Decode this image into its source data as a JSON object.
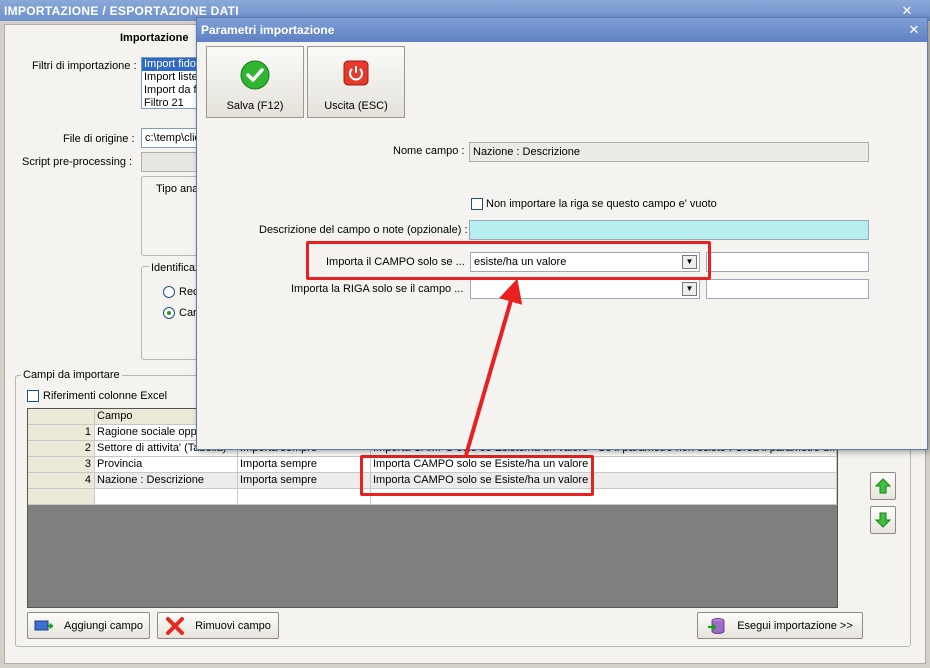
{
  "main_window": {
    "title": "IMPORTAZIONE / ESPORTAZIONE DATI",
    "section_title": "Importazione",
    "filters_label": "Filtri di importazione :",
    "filters": [
      "Import fido",
      "Import liste",
      "Import da f",
      "Filtro 21"
    ],
    "origin_file_label": "File di origine :",
    "origin_file_value": "c:\\temp\\clie",
    "script_label": "Script pre-processing :",
    "type_label": "Tipo ana",
    "identification_label": "Identificaz",
    "radio_1": "Rec",
    "radio_2": "Car",
    "fields_group_label": "Campi da importare",
    "excel_refs_label": "Riferimenti colonne Excel",
    "grid_header_campo": "Campo",
    "rows": [
      {
        "n": "1",
        "campo": "Ragione sociale oppu",
        "mode": "",
        "cond": ""
      },
      {
        "n": "2",
        "campo": "Settore di attivita' (Tabella)",
        "mode": "Importa sempre",
        "cond": "Importa CAMPO solo se Esiste/ha un valore - Se il parametro non esiste : Crea il parametro d..."
      },
      {
        "n": "3",
        "campo": "Provincia",
        "mode": "Importa sempre",
        "cond": "Importa CAMPO solo se Esiste/ha un valore"
      },
      {
        "n": "4",
        "campo": "Nazione : Descrizione",
        "mode": "Importa sempre",
        "cond": "Importa CAMPO solo se Esiste/ha un valore"
      }
    ],
    "add_field_button": "Aggiungi campo",
    "remove_field_button": "Rimuovi campo",
    "run_import_button": "Esegui importazione >>"
  },
  "dialog": {
    "title": "Parametri importazione",
    "save_button": "Salva (F12)",
    "exit_button": "Uscita (ESC)",
    "field_name_label": "Nome campo :",
    "field_name_value": "Nazione : Descrizione",
    "skip_empty_label": "Non importare la riga se questo campo e' vuoto",
    "notes_label": "Descrizione del campo o note (opzionale) :",
    "notes_value": "",
    "import_field_if_label": "Importa il CAMPO solo se ...",
    "import_field_if_value": "esiste/ha un valore",
    "import_row_if_label": "Importa la RIGA solo se il campo ...",
    "import_row_if_value": ""
  },
  "colors": {
    "titlebar": "#6d8fcc",
    "highlight": "#e82020",
    "notes_bg": "#b6eef0",
    "selection": "#316ac5"
  }
}
